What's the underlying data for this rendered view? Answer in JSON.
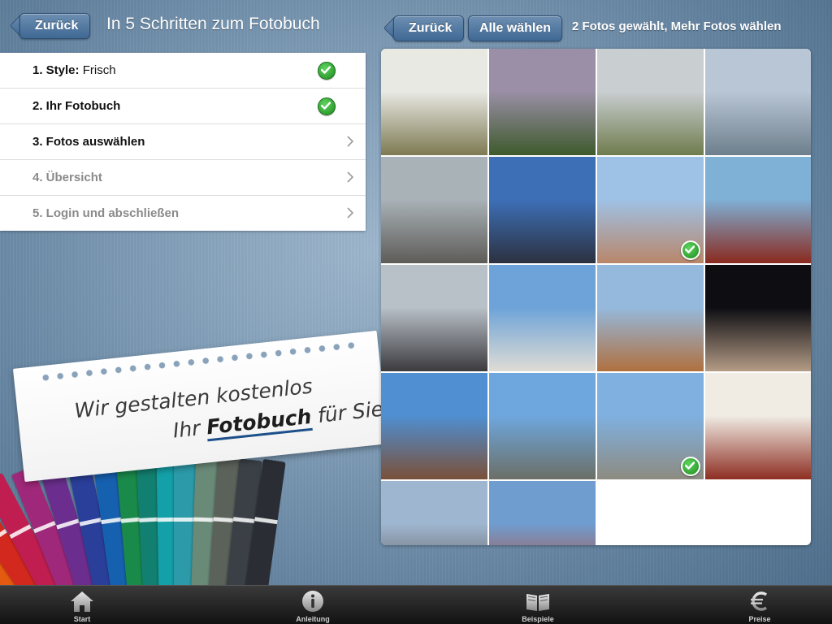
{
  "left_header": {
    "back_label": "Zurück",
    "title": "In 5 Schritten zum Fotobuch"
  },
  "steps": [
    {
      "label": "1. Style:",
      "value": "Frisch",
      "state": "done"
    },
    {
      "label": "2. Ihr Fotobuch",
      "value": "",
      "state": "done"
    },
    {
      "label": "3. Fotos auswählen",
      "value": "",
      "state": "active"
    },
    {
      "label": "4. Übersicht",
      "value": "",
      "state": "disabled"
    },
    {
      "label": "5. Login und abschließen",
      "value": "",
      "state": "disabled"
    }
  ],
  "promo": {
    "line1": "Wir gestalten kostenlos",
    "line2_prefix": "Ihr",
    "line2_highlight": "Fotobuch",
    "line2_suffix": "für Sie"
  },
  "right_header": {
    "back_label": "Zurück",
    "select_all_label": "Alle wählen",
    "status": "2 Fotos gewählt, Mehr Fotos wählen"
  },
  "photos": [
    {
      "subject": "waterfall-closeup",
      "selected": false,
      "colors": [
        "#e9e9e4",
        "#7d7a52"
      ]
    },
    {
      "subject": "waterfall-valley",
      "selected": false,
      "colors": [
        "#9a8fa6",
        "#3e5a2c"
      ]
    },
    {
      "subject": "tower-flowers",
      "selected": false,
      "colors": [
        "#c9ced1",
        "#6f7c4d"
      ]
    },
    {
      "subject": "lake-mountains",
      "selected": false,
      "colors": [
        "#b9c6d6",
        "#6d7f8c"
      ]
    },
    {
      "subject": "rocky-slope",
      "selected": false,
      "colors": [
        "#a9b2b7",
        "#5e5c58"
      ]
    },
    {
      "subject": "jeep-road",
      "selected": false,
      "colors": [
        "#3d6fb7",
        "#2c3140"
      ]
    },
    {
      "subject": "golden-gate-sky",
      "selected": true,
      "colors": [
        "#9ec2e6",
        "#b9866a"
      ]
    },
    {
      "subject": "pagoda",
      "selected": false,
      "colors": [
        "#7fb0d6",
        "#8a2a1e"
      ]
    },
    {
      "subject": "street-dusk",
      "selected": false,
      "colors": [
        "#b8c0c8",
        "#3c3b3e"
      ]
    },
    {
      "subject": "white-dunes",
      "selected": false,
      "colors": [
        "#6da3d8",
        "#dfdcd5"
      ]
    },
    {
      "subject": "red-canyon",
      "selected": false,
      "colors": [
        "#95b9dc",
        "#b0703f"
      ]
    },
    {
      "subject": "las-vegas-night",
      "selected": false,
      "colors": [
        "#0d0d12",
        "#b49c86"
      ]
    },
    {
      "subject": "old-house",
      "selected": false,
      "colors": [
        "#4f8fd2",
        "#7a5038"
      ]
    },
    {
      "subject": "yosemite-valley",
      "selected": false,
      "colors": [
        "#6ea7de",
        "#6b6f66"
      ]
    },
    {
      "subject": "half-dome",
      "selected": true,
      "colors": [
        "#7fb0e0",
        "#8d8b80"
      ]
    },
    {
      "subject": "red-textile",
      "selected": false,
      "colors": [
        "#f0ece4",
        "#8e2e22"
      ]
    },
    {
      "subject": "city-street",
      "selected": false,
      "colors": [
        "#9fb6d0",
        "#5a5552"
      ]
    },
    {
      "subject": "golden-gate-tower",
      "selected": false,
      "colors": [
        "#6f9dd0",
        "#b8452a"
      ]
    }
  ],
  "tabbar": [
    {
      "label": "Start",
      "icon": "home-icon"
    },
    {
      "label": "Anleitung",
      "icon": "info-icon"
    },
    {
      "label": "Beispiele",
      "icon": "book-icon"
    },
    {
      "label": "Preise",
      "icon": "euro-icon"
    }
  ]
}
